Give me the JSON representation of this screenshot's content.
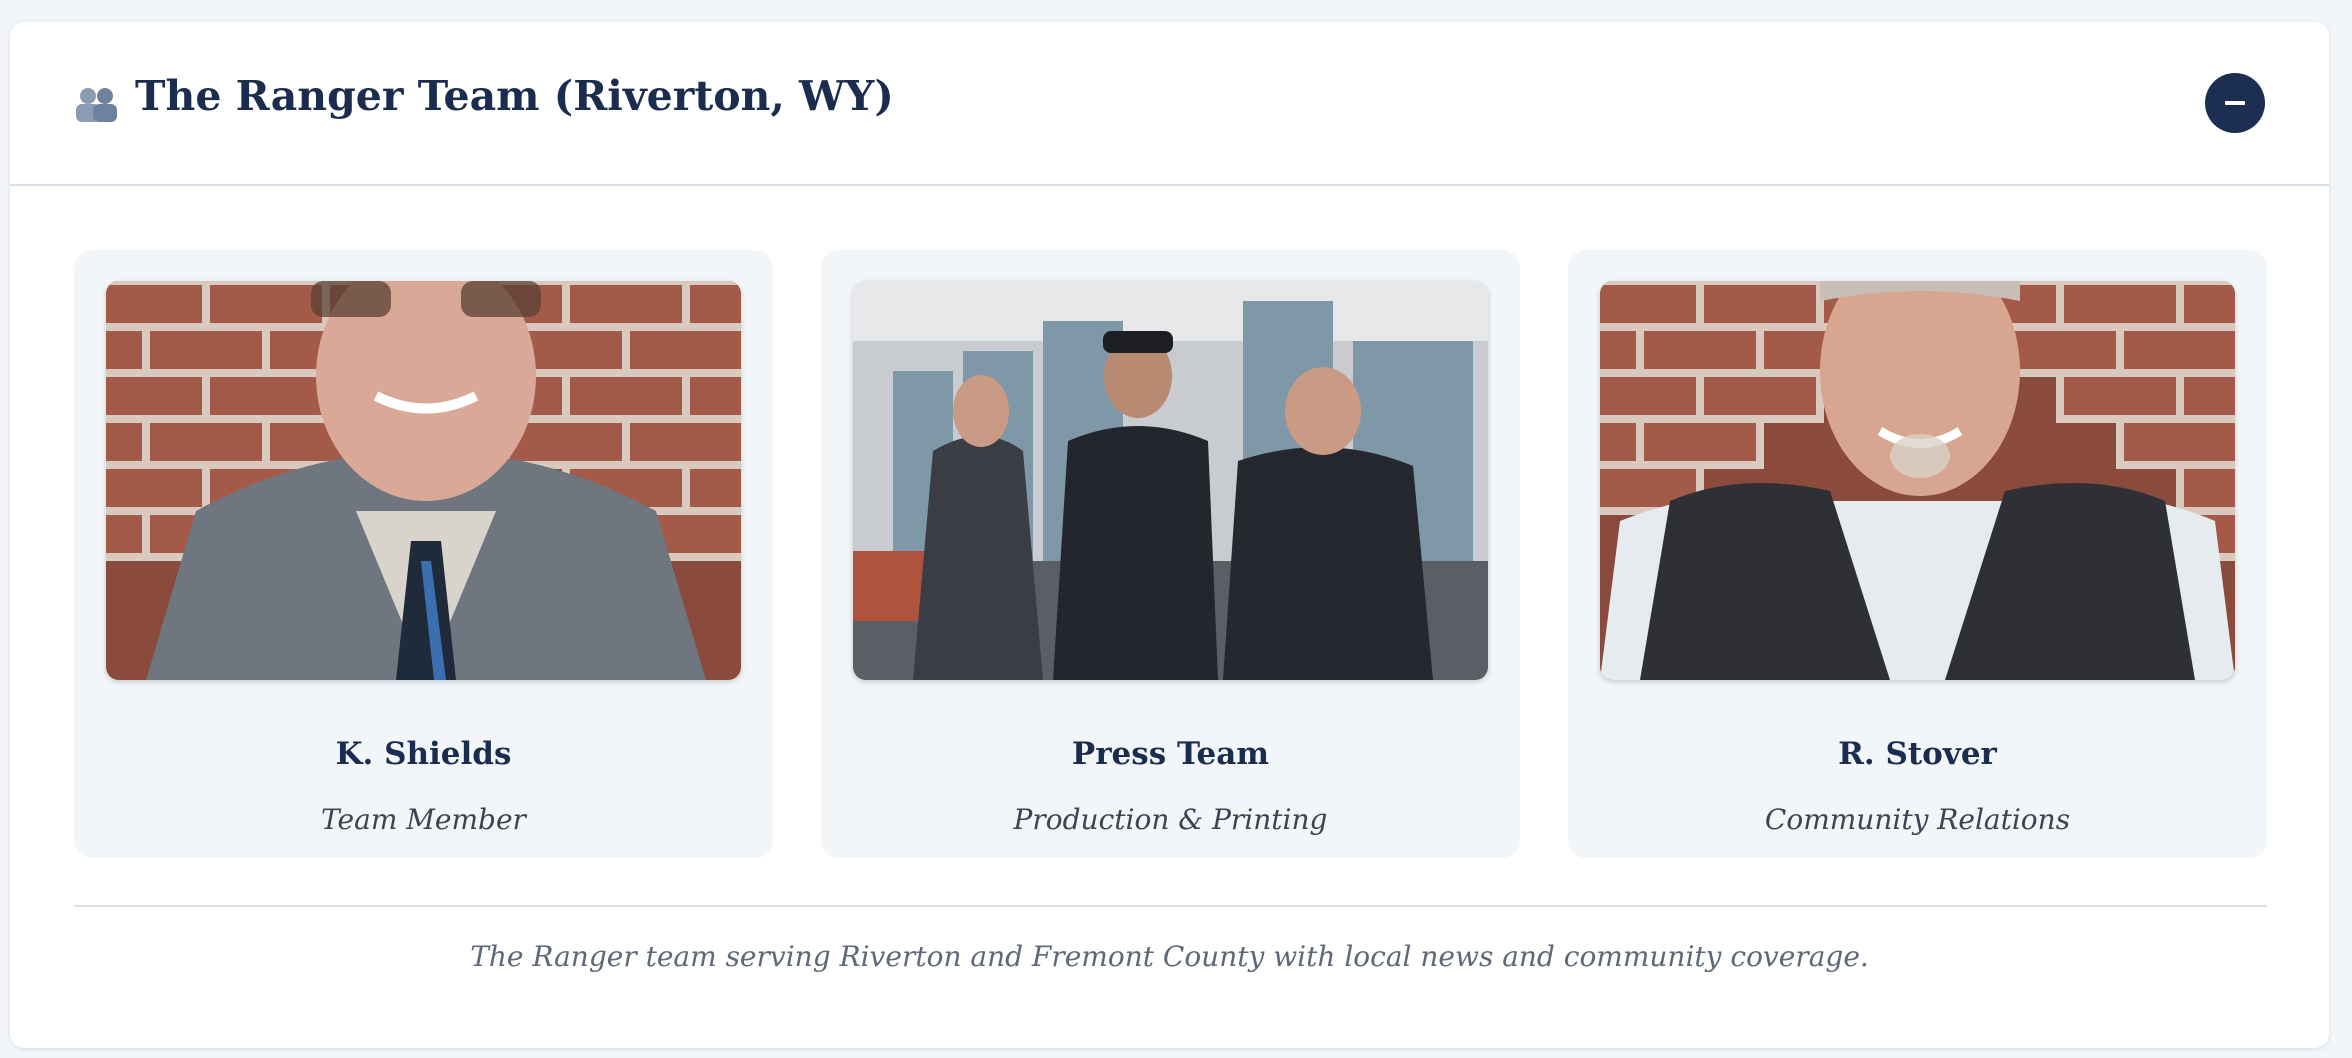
{
  "section": {
    "title": "The Ranger Team (Riverton, WY)",
    "icon": "people-icon",
    "collapse_icon": "minus-icon"
  },
  "team": [
    {
      "name": "K. Shields",
      "role": "Team Member",
      "photo": "portrait-photo"
    },
    {
      "name": "Press Team",
      "role": "Production & Printing",
      "photo": "group-photo"
    },
    {
      "name": "R. Stover",
      "role": "Community Relations",
      "photo": "portrait-photo"
    }
  ],
  "caption": "The Ranger team serving Riverton and Fremont County with local news and community coverage.",
  "colors": {
    "accent": "#1c2e52",
    "title": "#1b2d4f",
    "card_bg": "#f3f6f9",
    "divider": "#d8dee6"
  }
}
